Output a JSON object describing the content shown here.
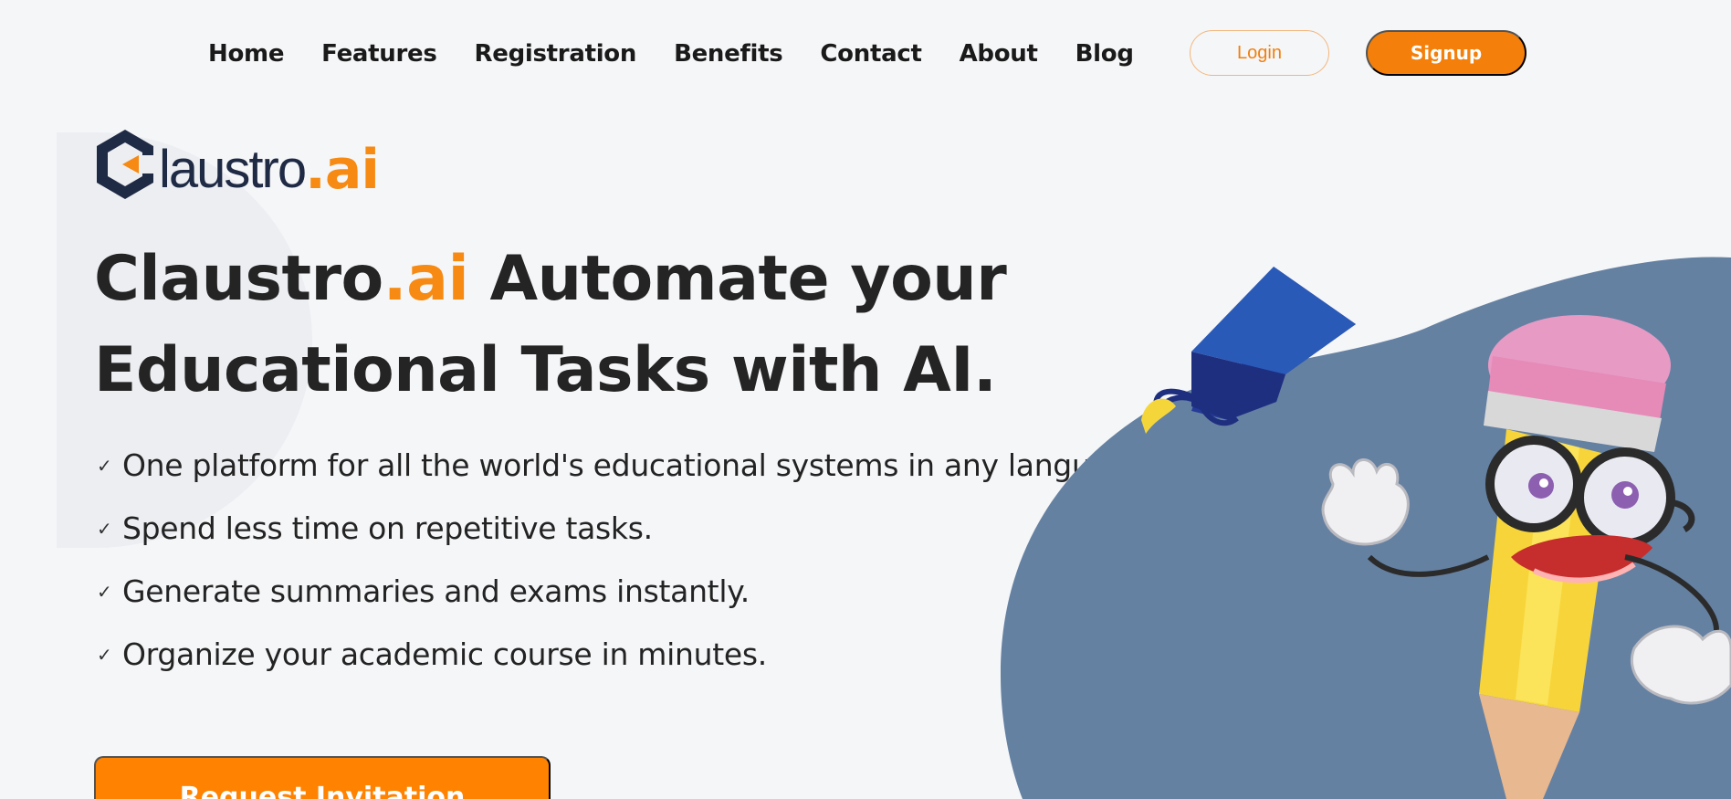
{
  "nav": {
    "links": [
      "Home",
      "Features",
      "Registration",
      "Benefits",
      "Contact",
      "About",
      "Blog"
    ],
    "login_label": "Login",
    "signup_label": "Signup"
  },
  "logo": {
    "text": "laustro",
    "ai": ".ai"
  },
  "hero": {
    "headline_brand": "Claustro",
    "headline_brand_ai": ".ai",
    "headline_line1_rest": " Automate your",
    "headline_line2": "Educational Tasks with AI.",
    "features": [
      "One platform for all the world's educational systems in any langu",
      "Spend less time on repetitive tasks.",
      "Generate summaries and exams instantly.",
      "Organize your academic course in minutes."
    ],
    "check_glyph": "✓",
    "cta_label": "Request Invitation"
  },
  "colors": {
    "accent": "#f68a12",
    "button_orange": "#ff8200",
    "blob": "#6581a2",
    "background": "#f5f6f8"
  },
  "icons": {
    "logo_mark": "claustro-logo-icon",
    "mascot": "pencil-mascot-graduate-illustration"
  }
}
